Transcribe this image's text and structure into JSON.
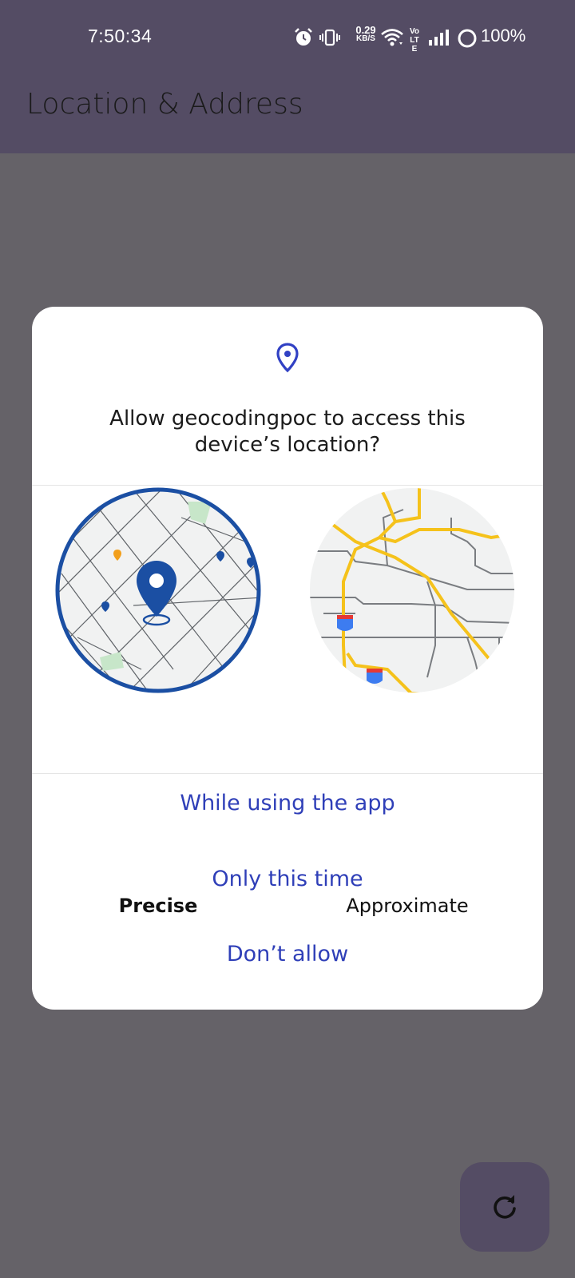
{
  "status_bar": {
    "time": "7:50:34",
    "net_speed_value": "0.29",
    "net_speed_unit": "KB/S",
    "volte": "Vo LTE",
    "battery": "100%",
    "icons": [
      "alarm-icon",
      "vibrate-icon",
      "wifi-icon",
      "volte-icon",
      "signal-icon",
      "battery-icon"
    ]
  },
  "app_bar": {
    "title": "Location & Address"
  },
  "dialog": {
    "icon": "location-pin-icon",
    "title": "Allow geocodingpoc to access this device’s location?",
    "precise_label": "Precise",
    "approximate_label": "Approximate",
    "selected_option": "Precise",
    "actions": {
      "while_using": "While using the app",
      "only_this_time": "Only this time",
      "dont_allow": "Don’t allow"
    }
  },
  "fab": {
    "icon": "refresh-icon"
  },
  "colors": {
    "app_bar": "#544c64",
    "scrim": "#656268",
    "accent": "#2f3fb8",
    "map_blue": "#1b4fa3",
    "road_yellow": "#f5c21b"
  }
}
